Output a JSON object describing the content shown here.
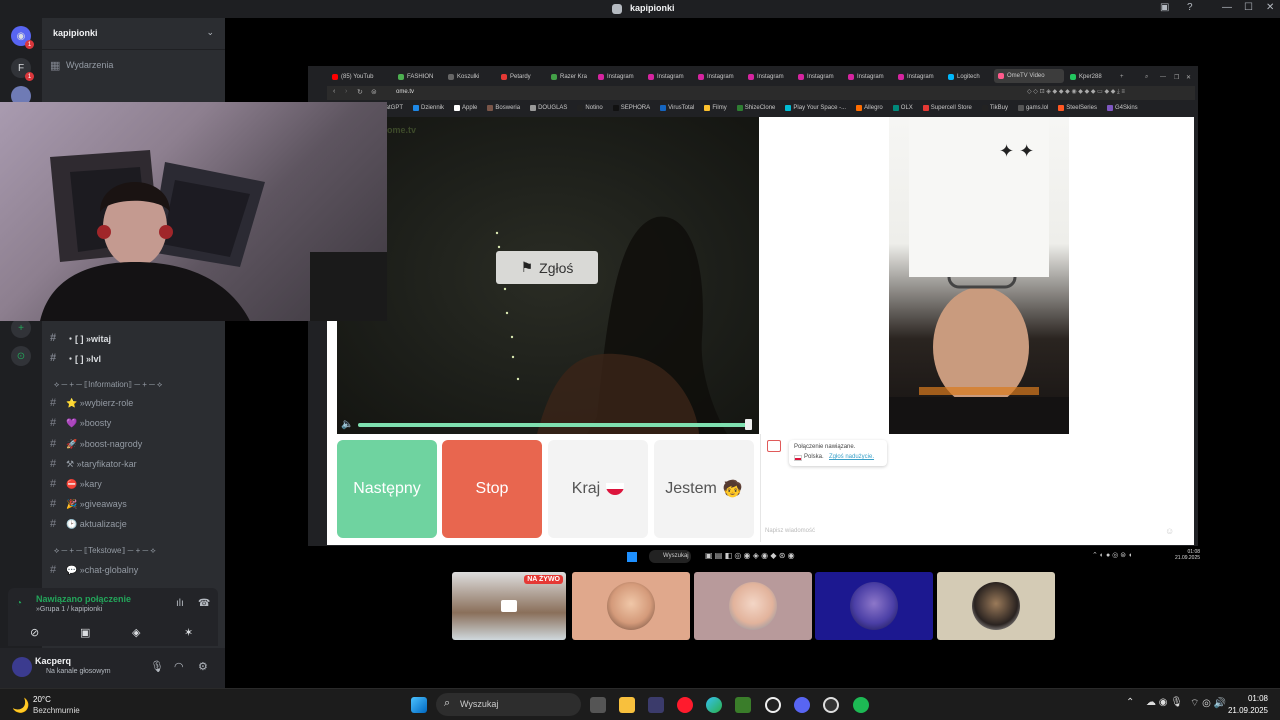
{
  "window": {
    "title": "kapipionki",
    "controls": {
      "minimize": "—",
      "maximize": "☐",
      "close": "✕"
    }
  },
  "discord": {
    "server_name": "kapipionki",
    "events_label": "Wydarzenia",
    "rail_badges": [
      "1",
      "1"
    ],
    "channels": [
      {
        "label": "・[ ]  »witaj"
      },
      {
        "label": "・[ ]  »lvl"
      }
    ],
    "categories": [
      {
        "label": "⟡ ─ + ─ ⟦Information⟧ ─ + ─ ⟡"
      },
      {
        "label": "⟡ ─ + ─ ⟦Tekstowe⟧ ─ + ─ ⟡"
      }
    ],
    "info_channels": [
      {
        "label": "⭐ »wybierz-role"
      },
      {
        "label": "💜 »boosty"
      },
      {
        "label": "🚀 »boost-nagrody"
      },
      {
        "label": "⚒ »taryfikator-kar"
      },
      {
        "label": "⛔ »kary"
      },
      {
        "label": "🎉 »giveaways"
      },
      {
        "label": "🕑 aktualizacje"
      }
    ],
    "text_channels": [
      {
        "label": "💬 »chat-globalny"
      }
    ],
    "voice": {
      "status": "Nawiązano połączenie",
      "channel": "»Grupa 1 / kapipionki"
    },
    "user": {
      "name": "Kacperq",
      "status": "Na kanale głosowym"
    }
  },
  "browser": {
    "url": "ome.tv",
    "tabs": [
      "(85) YouTub",
      "FASHION",
      "Koszulki",
      "Petardy",
      "Razer Kra",
      "Instagram",
      "Instagram",
      "Instagram",
      "Instagram",
      "Instagram",
      "Instagram",
      "Instagram",
      "Logitech",
      "OmeTV Video",
      "Kper288"
    ],
    "bookmarks": [
      "ChatGPT",
      "Dziennik",
      "Apple",
      "Bosweria",
      "DOUGLAS",
      "Notino",
      "SEPHORA",
      "VirusTotal",
      "Filmy",
      "ShizeClone",
      "Play Your Space -...",
      "Allegro",
      "OLX",
      "Supercell Store",
      "TikBuy",
      "gams.lol",
      "SteelSeries",
      "G4Skins"
    ],
    "watermark": "ome.tv"
  },
  "ometv": {
    "report_label": "Zgłoś",
    "progress": 1.0,
    "buttons": {
      "next": "Następny",
      "stop": "Stop",
      "country": "Kraj",
      "country_flag": "🇵🇱",
      "iam": "Jestem",
      "iam_emoji": "🧒"
    },
    "chat": {
      "connected": "Połączenie nawiązane.",
      "country": "Polska.",
      "report_abuse": "Zgłoś nadużycie.",
      "placeholder": "Napisz wiadomość"
    },
    "colors": {
      "next": "#5fc98f",
      "stop": "#e5604c",
      "light": "#f2f2f2"
    }
  },
  "inner_taskbar": {
    "search": "Wyszukaj",
    "time": "01:08",
    "date": "21.09.2025"
  },
  "stream": {
    "live_badge": "NA ŻYWO"
  },
  "taskbar": {
    "weather_temp": "20°C",
    "weather_desc": "Bezchmurnie",
    "search": "Wyszukaj",
    "time": "01:08",
    "date": "21.09.2025"
  }
}
